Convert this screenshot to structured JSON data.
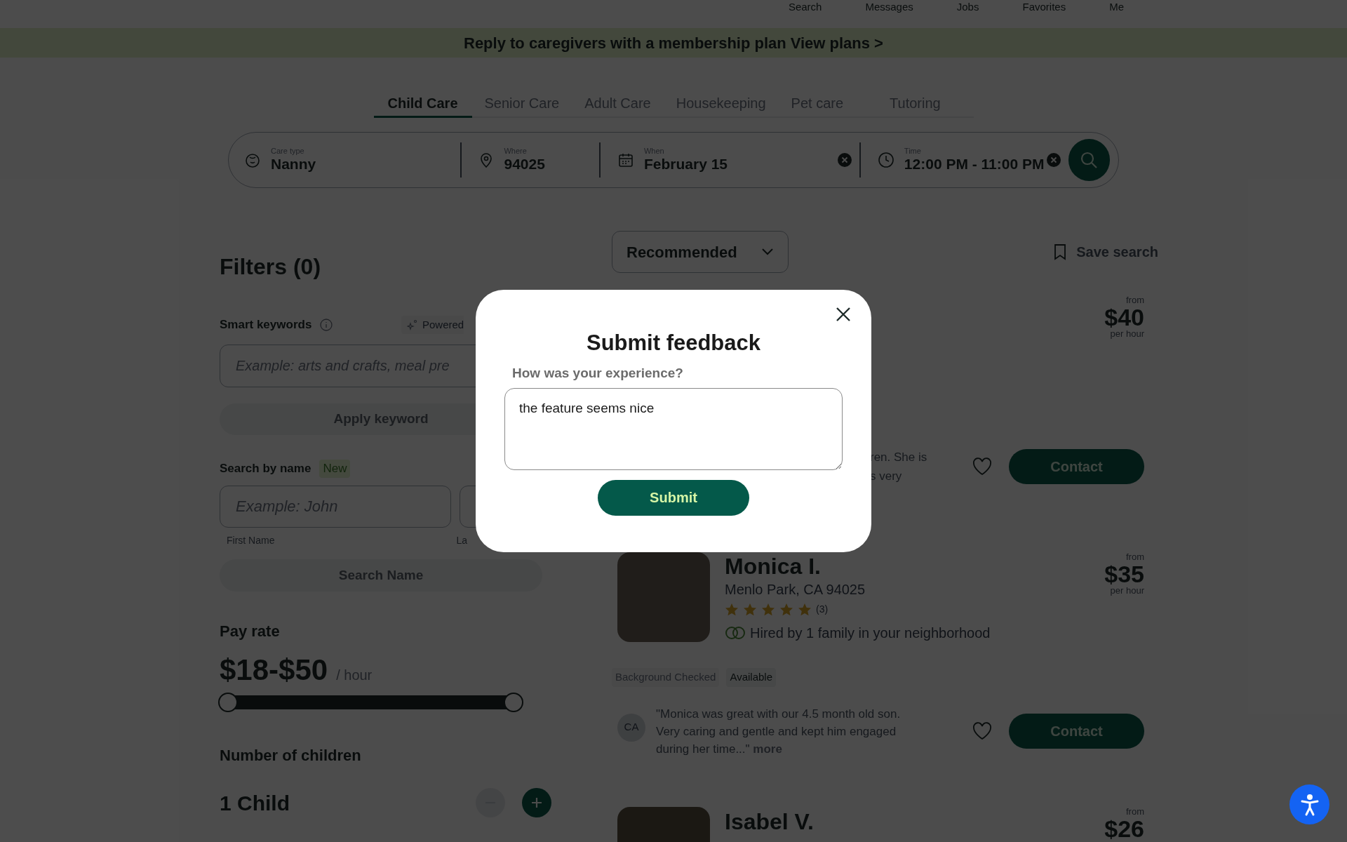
{
  "top_nav": [
    {
      "label": "Search"
    },
    {
      "label": "Messages"
    },
    {
      "label": "Jobs"
    },
    {
      "label": "Favorites"
    },
    {
      "label": "Me"
    }
  ],
  "banner": {
    "text": "Reply to caregivers with a membership plan",
    "link": "View plans >"
  },
  "care_tabs": [
    {
      "label": "Child Care",
      "selected": true
    },
    {
      "label": "Senior Care",
      "selected": false
    },
    {
      "label": "Adult Care",
      "selected": false
    },
    {
      "label": "Housekeeping",
      "selected": false
    },
    {
      "label": "Pet care",
      "selected": false
    },
    {
      "label": "Tutoring",
      "selected": false
    }
  ],
  "search_bar": {
    "fields": [
      {
        "kind": "care",
        "label": "Care type",
        "value": "Nanny",
        "clearable": false
      },
      {
        "kind": "where",
        "label": "Where",
        "value": "94025",
        "clearable": false
      },
      {
        "kind": "when",
        "label": "When",
        "value": "February 15",
        "clearable": true
      },
      {
        "kind": "time",
        "label": "Time",
        "value": "12:00 PM - 11:00 PM",
        "clearable": true
      }
    ]
  },
  "filters": {
    "title": "Filters (0)",
    "smart_keywords": {
      "label": "Smart keywords",
      "powered": "Powered",
      "placeholder": "Example: arts and crafts, meal pre",
      "button": "Apply keyword",
      "disabled": true
    },
    "search_by_name": {
      "label": "Search by name",
      "badge": "New",
      "first_placeholder": "Example: John",
      "first_label": "First Name",
      "last_label": "La",
      "button": "Search Name",
      "disabled": true
    },
    "pay_rate": {
      "label": "Pay rate",
      "range": "$18-$50",
      "unit": "/ hour",
      "thumbs": [
        {
          "level": 0
        },
        {
          "level": 1
        }
      ]
    },
    "children": {
      "label": "Number of children",
      "value": "1 Child",
      "minus_disabled": true,
      "plus_disabled": false
    }
  },
  "results": {
    "sort": "Recommended",
    "save_search": "Save search",
    "cards": [
      {
        "kind": "covered",
        "rate_from": "from",
        "rate": "$40",
        "rate_unit": "per hour",
        "review_lines": [
          "ren. She is",
          "s very"
        ],
        "favorited": false,
        "contact": "Contact"
      },
      {
        "kind": "full",
        "name": "Monica I.",
        "location": "Menlo Park, CA 94025",
        "stars": 5,
        "review_count": "(3)",
        "hired": "Hired by 1 family in your neighborhood",
        "rate_from": "from",
        "rate": "$35",
        "rate_unit": "per hour",
        "tags": [
          "Background Checked",
          "Available"
        ],
        "reviewer": "CA",
        "review": "\"Monica was great with our 4.5 month old son. Very caring and gentle and kept him engaged during her time...\"",
        "more": "more",
        "favorited": false,
        "contact": "Contact"
      },
      {
        "kind": "cut",
        "name": "Isabel V.",
        "rate_from": "from",
        "rate": "$26"
      }
    ]
  },
  "modal": {
    "title": "Submit feedback",
    "label": "How was your experience?",
    "value": "the feature seems nice",
    "submit": "Submit"
  }
}
